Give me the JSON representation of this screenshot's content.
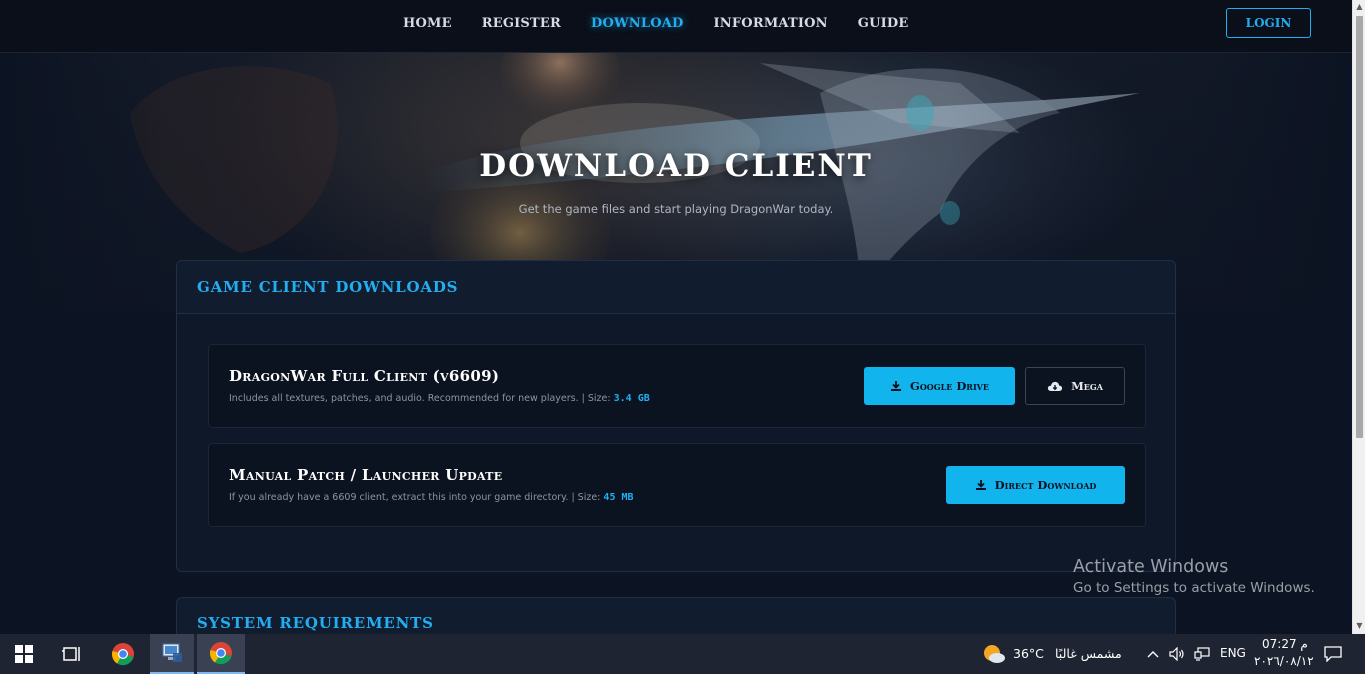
{
  "nav": {
    "links": [
      {
        "label": "HOME"
      },
      {
        "label": "REGISTER"
      },
      {
        "label": "DOWNLOAD"
      },
      {
        "label": "INFORMATION"
      },
      {
        "label": "GUIDE"
      }
    ],
    "active": "DOWNLOAD",
    "login_label": "LOGIN"
  },
  "hero": {
    "title": "DOWNLOAD CLIENT",
    "subtitle": "Get the game files and start playing DragonWar today."
  },
  "downloads_card": {
    "title": "GAME CLIENT DOWNLOADS",
    "items": [
      {
        "title": "DragonWar Full Client (v6609)",
        "description": "Includes all textures, patches, and audio. Recommended for new players. | Size:",
        "size": "3.4 GB",
        "buttons": [
          {
            "label": "Google Drive",
            "icon": "download-icon",
            "style": "primary"
          },
          {
            "label": "Mega",
            "icon": "cloud-download-icon",
            "style": "secondary"
          }
        ]
      },
      {
        "title": "Manual Patch / Launcher Update",
        "description": "If you already have a 6609 client, extract this into your game directory. | Size:",
        "size": "45 MB",
        "buttons": [
          {
            "label": "Direct Download",
            "icon": "download-icon",
            "style": "primary"
          }
        ]
      }
    ]
  },
  "requirements_card": {
    "title": "SYSTEM REQUIREMENTS"
  },
  "watermark": {
    "line1": "Activate Windows",
    "line2": "Go to Settings to activate Windows."
  },
  "taskbar": {
    "weather_temp": "36°C",
    "weather_desc": "مشمس غالبًا",
    "language": "ENG",
    "time": "07:27 م",
    "date": "٢٠٢٦/٠٨/١٢"
  },
  "colors": {
    "accent": "#22aef0",
    "button_primary": "#12b4ee",
    "background": "#0c1322",
    "card": "#0f1829"
  }
}
